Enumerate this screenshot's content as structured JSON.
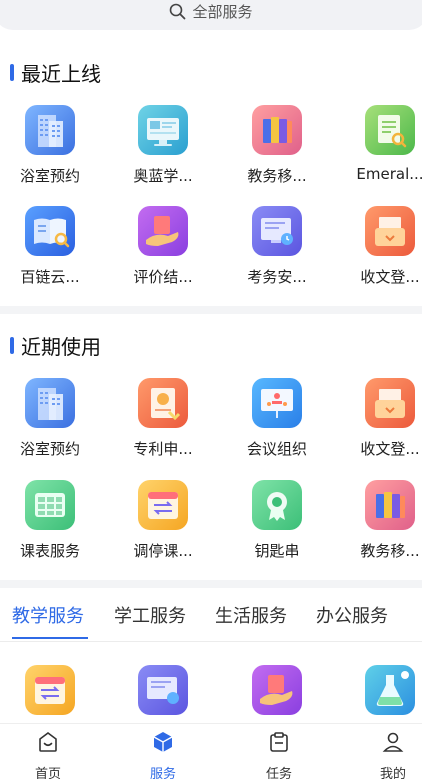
{
  "search": {
    "placeholder": "全部服务"
  },
  "sections": {
    "recent": {
      "title": "最近上线"
    },
    "used": {
      "title": "近期使用"
    }
  },
  "recent_row1": [
    "浴室预约",
    "奥蓝学...",
    "教务移...",
    "Emeral..."
  ],
  "recent_row2": [
    "百链云...",
    "评价结...",
    "考务安...",
    "收文登..."
  ],
  "used_row1": [
    "浴室预约",
    "专利申...",
    "会议组织",
    "收文登..."
  ],
  "used_row2": [
    "课表服务",
    "调停课...",
    "钥匙串",
    "教务移..."
  ],
  "tabs": [
    "教学服务",
    "学工服务",
    "生活服务",
    "办公服务"
  ],
  "bottom_nav": [
    "首页",
    "服务",
    "任务",
    "我的"
  ],
  "colors": {
    "accent": "#2f6ae6"
  }
}
